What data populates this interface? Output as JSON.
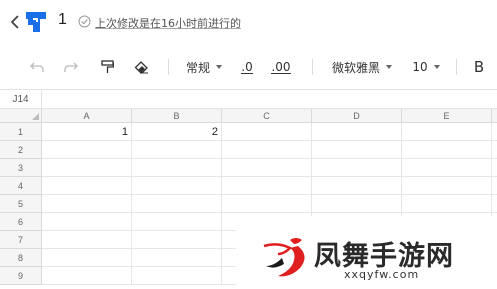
{
  "header": {
    "doc_title": "1",
    "last_edit": "上次修改是在16小时前进行的",
    "colors": {
      "logo": "#1a6fe8"
    }
  },
  "toolbar": {
    "icons": [
      "undo-icon",
      "redo-icon",
      "format-painter-icon",
      "eraser-icon"
    ],
    "number_format": "常规",
    "decrease_decimal": ".0",
    "increase_decimal": ".00",
    "font_family": "微软雅黑",
    "font_size": "10",
    "bold": "B"
  },
  "formula_bar": {
    "cell_ref": "J14"
  },
  "sheet": {
    "columns": [
      "A",
      "B",
      "C",
      "D",
      "E"
    ],
    "rows": [
      "1",
      "2",
      "3",
      "4",
      "5",
      "6",
      "7",
      "8",
      "9"
    ],
    "cells": {
      "A1": "1",
      "B1": "2"
    }
  },
  "watermark": {
    "name": "凤舞手游网",
    "url": "xxqyfw.com",
    "colors": {
      "accent": "#e02020"
    }
  }
}
